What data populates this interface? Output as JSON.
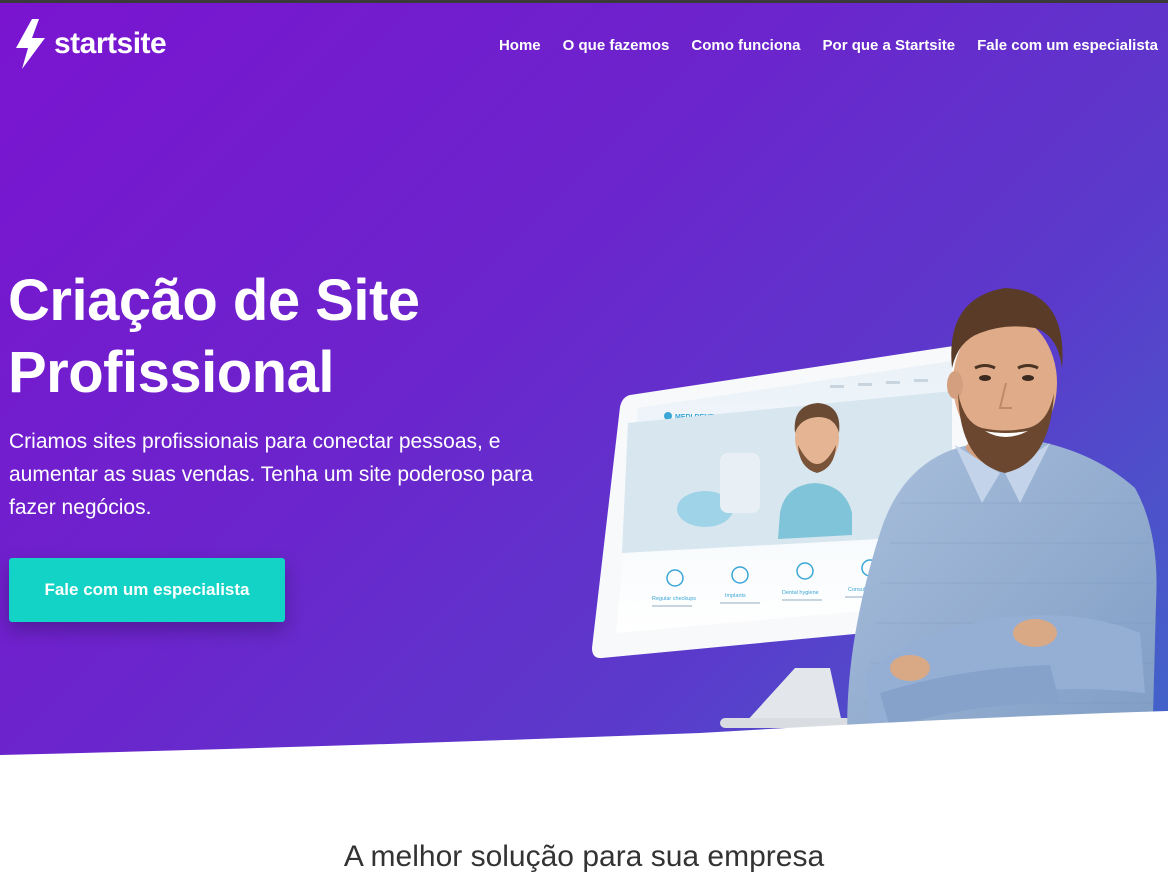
{
  "header": {
    "logo_text": "startsite",
    "nav": [
      {
        "label": "Home"
      },
      {
        "label": "O que fazemos"
      },
      {
        "label": "Como funciona"
      },
      {
        "label": "Por que a Startsite"
      },
      {
        "label": "Fale com um especialista"
      }
    ]
  },
  "hero": {
    "headline_line1": "Criação de Site",
    "headline_line2": "Profissional",
    "subtitle": "Criamos sites profissionais para conectar pessoas, e aumentar as suas vendas. Tenha um site poderoso para fazer negócios.",
    "cta_label": "Fale com um especialista",
    "mockup": {
      "brand": "MEDI DENT",
      "services": [
        "Regular checkups",
        "Implants",
        "Dental hygiene",
        "Consultations"
      ]
    }
  },
  "section": {
    "title": "A melhor solução para sua empresa"
  },
  "colors": {
    "gradient_start": "#7a14d0",
    "gradient_end": "#3f68c9",
    "cta": "#12d3c5",
    "text_dark": "#333333"
  },
  "icons": {
    "logo": "lightning-bolt-icon"
  }
}
